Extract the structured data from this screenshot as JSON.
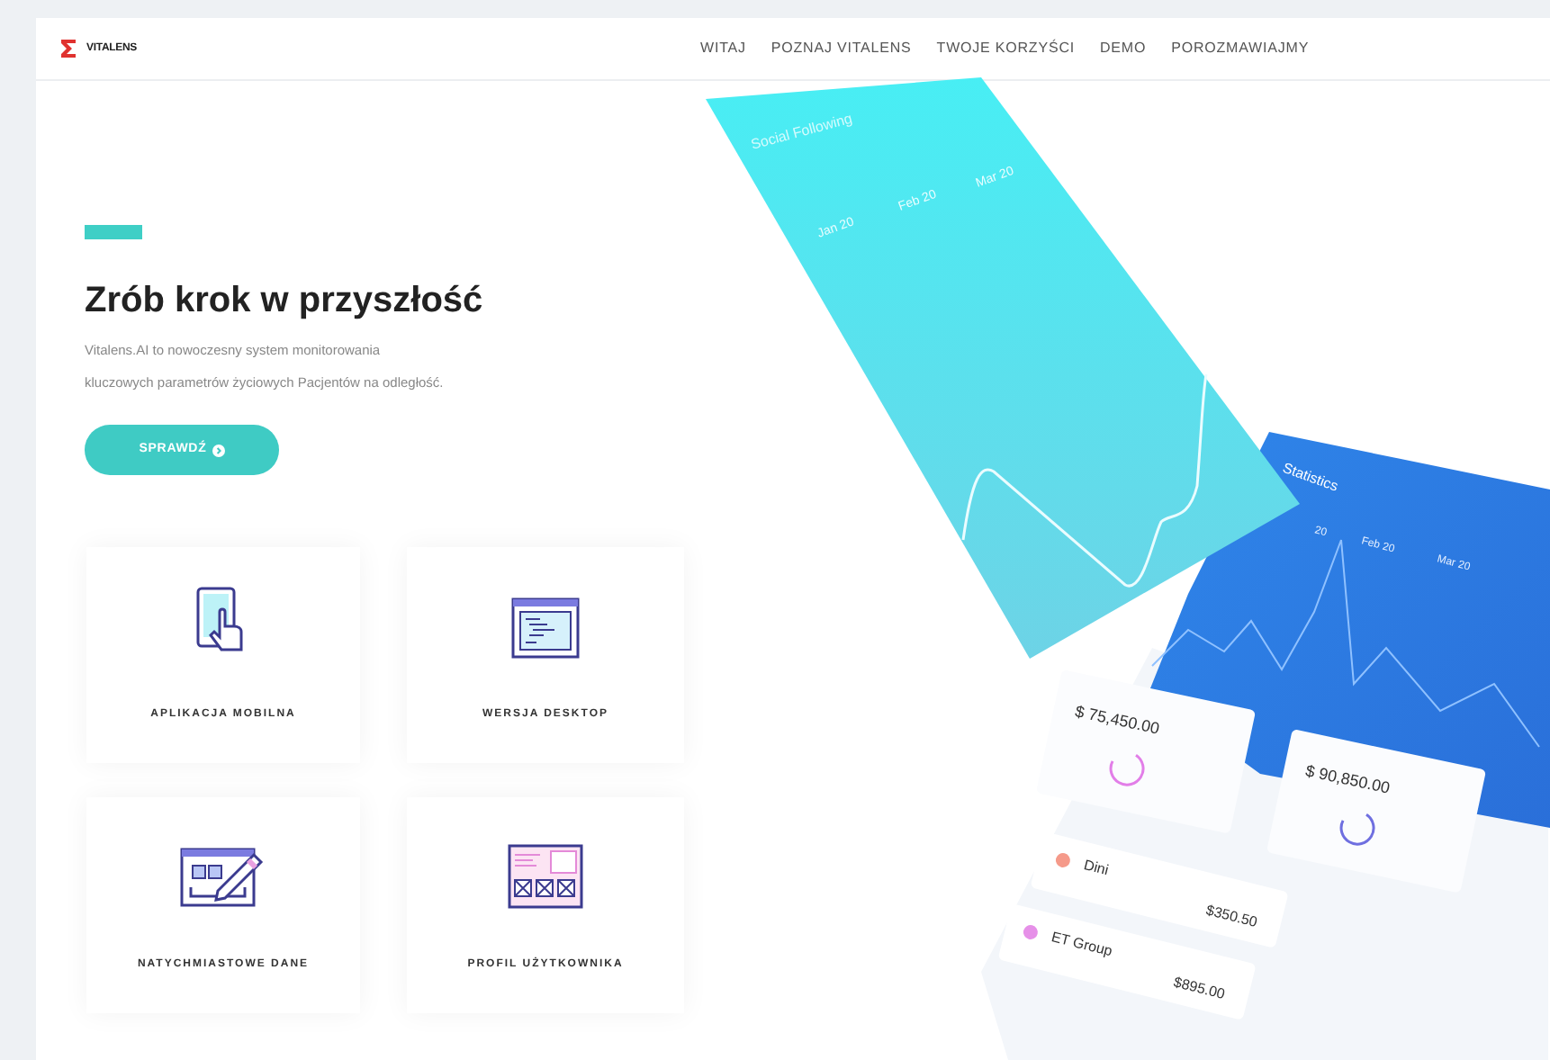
{
  "brand": {
    "name": "VITALENS"
  },
  "nav": [
    {
      "label": "WITAJ"
    },
    {
      "label": "POZNAJ VITALENS"
    },
    {
      "label": "TWOJE KORZYŚCI"
    },
    {
      "label": "DEMO"
    },
    {
      "label": "POROZMAWIAJMY"
    }
  ],
  "hero": {
    "title": "Zrób krok w przyszłość",
    "description": "Vitalens.AI to nowoczesny system monitorowania kluczowych parametrów życiowych Pacjentów na odległość.",
    "button": "SPRAWDŹ"
  },
  "features": [
    {
      "kind": "mobile",
      "label": "APLIKACJA MOBILNA"
    },
    {
      "kind": "desktop",
      "label": "WERSJA DESKTOP"
    },
    {
      "kind": "data",
      "label": "NATYCHMIASTOWE DANE"
    },
    {
      "kind": "profile",
      "label": "PROFIL UŻYTKOWNIKA"
    }
  ],
  "mockup": {
    "social": {
      "title": "Social Following",
      "months": [
        "Jan 20",
        "Feb 20",
        "Mar 20"
      ]
    },
    "statistics": {
      "title": "Statistics",
      "months": [
        "20",
        "Feb 20",
        "Mar 20"
      ]
    },
    "stat_cards": [
      {
        "amount": "$ 75,450.00",
        "color": "#e27ee8"
      },
      {
        "amount": "$ 90,850.00",
        "color": "#6f6fe0"
      }
    ],
    "transactions": [
      {
        "name": "Dini",
        "amount": "$350.50",
        "color": "#f59a8a"
      },
      {
        "name": "ET Group",
        "amount": "$895.00",
        "color": "#e690e8"
      }
    ]
  }
}
